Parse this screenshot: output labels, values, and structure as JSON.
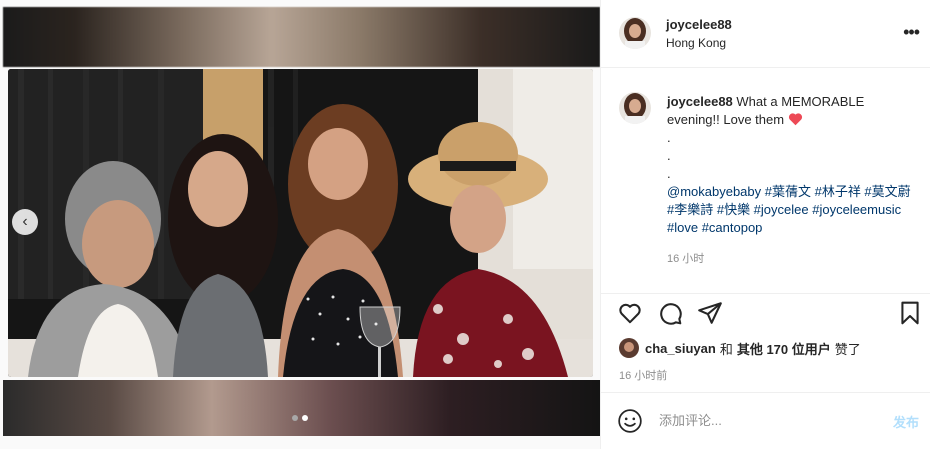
{
  "post": {
    "username": "joycelee88",
    "location": "Hong Kong"
  },
  "caption": {
    "username": "joycelee88",
    "text": "What a MEMORABLE evening!! Love them",
    "dots": [
      ".",
      ".",
      "."
    ],
    "tags": "@mokabyebaby #葉蒨文 #林子祥 #莫文蔚 #李樂詩 #快樂 #joycelee #joyceleemusic #love #cantopop",
    "time": "16 小时"
  },
  "likes": {
    "user": "cha_siuyan",
    "connector": "和",
    "others": "其他 170 位用户",
    "suffix": "赞了"
  },
  "posted_time": "16 小时前",
  "comment": {
    "placeholder": "添加评论...",
    "post_label": "发布"
  },
  "carousel": {
    "total": 2,
    "active_index": 1
  },
  "icons": {
    "more": "more-horizontal-icon",
    "like": "heart-outline-icon",
    "comment": "comment-bubble-icon",
    "share": "paper-plane-icon",
    "save": "bookmark-icon",
    "emoji": "smiley-icon",
    "prev": "chevron-left-icon"
  },
  "colors": {
    "link": "#00376b",
    "muted": "#8e8e8e",
    "post_button": "#b2dffc",
    "heart": "#ed4956"
  }
}
